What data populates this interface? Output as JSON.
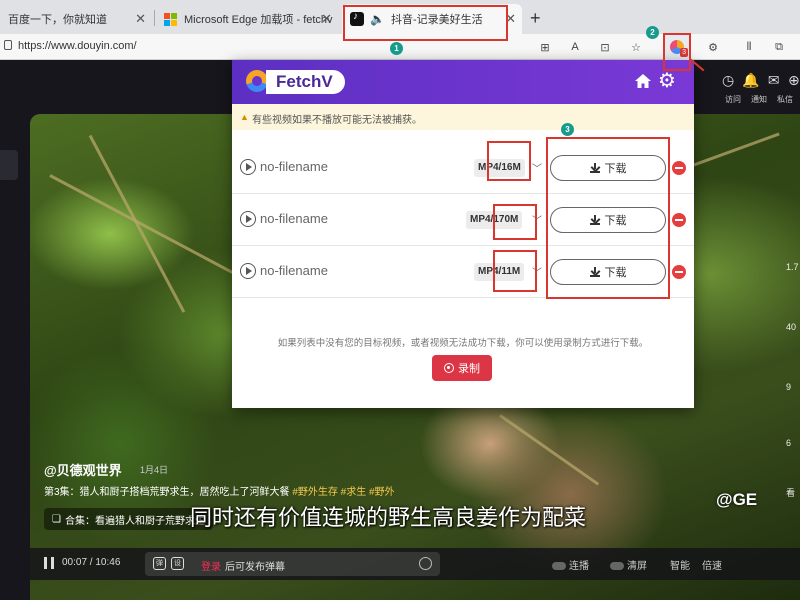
{
  "browser": {
    "tabs": [
      {
        "title": "百度一下，你就知道",
        "favicon": "baidu-icon",
        "active": false
      },
      {
        "title": "Microsoft Edge 加载项 - fetchv",
        "favicon": "microsoft-icon",
        "active": false
      },
      {
        "title": "抖音-记录美好生活",
        "favicon": "tiktok-icon",
        "active": true
      }
    ],
    "new_tab_glyph": "+",
    "close_glyph": "✕",
    "url": "https://www.douyin.com/",
    "toolbar_glyphs": {
      "read_aloud": "A",
      "immersive": "⊡",
      "favorites": "☆",
      "extensions": "⚙",
      "split": "⫴",
      "collections": "⧉"
    },
    "ext_badge": "3"
  },
  "douyin": {
    "right_labels": [
      "访问",
      "通知",
      "私信",
      "投稿"
    ],
    "side_counts": [
      "1.7",
      "40",
      "9",
      "6",
      "看"
    ],
    "author": "@贝德观世界",
    "author_date": "1月4日",
    "episode_text": "第3集：猎人和厨子搭档荒野求生，居然吃上了河鲜大餐",
    "episode_tags": "#野外生存 #求生 #野外",
    "collection_label": "合集：看遍猎人和厨子荒野求生",
    "subtitle": "同时还有价值连城的野生高良姜作为配菜",
    "time": "00:07 / 10:46",
    "danmu_icon1": "弹",
    "danmu_icon2": "设",
    "danmu_login": "登录",
    "danmu_after": "后可发布弹幕",
    "ctrl_labels": [
      "连播",
      "清屏",
      "智能",
      "倍速"
    ],
    "watermark": "@GE"
  },
  "fetchv": {
    "brand": "FetchV",
    "home_icon": "home-icon",
    "gear_glyph": "⚙",
    "notice_glyph": "▲",
    "notice": "有些视频如果不播放可能无法被捕获。",
    "items": [
      {
        "name": "no-filename",
        "format": "MP4/16M",
        "download_label": "下载"
      },
      {
        "name": "no-filename",
        "format": "MP4/170M",
        "download_label": "下载"
      },
      {
        "name": "no-filename",
        "format": "MP4/11M",
        "download_label": "下载"
      }
    ],
    "chevron_glyph": "﹀",
    "footer_note": "如果列表中没有您的目标视频，或者视频无法成功下载，你可以使用录制方式进行下载。",
    "record_label": "录制"
  },
  "annotations": {
    "badge_1": "1",
    "badge_2": "2",
    "badge_3": "3",
    "color": "#d9362e"
  },
  "colors": {
    "brand_purple": "#6a34cc",
    "danger_red": "#e53e3e",
    "record_red": "#dc3545",
    "notice_bg": "#fdf6dc"
  }
}
